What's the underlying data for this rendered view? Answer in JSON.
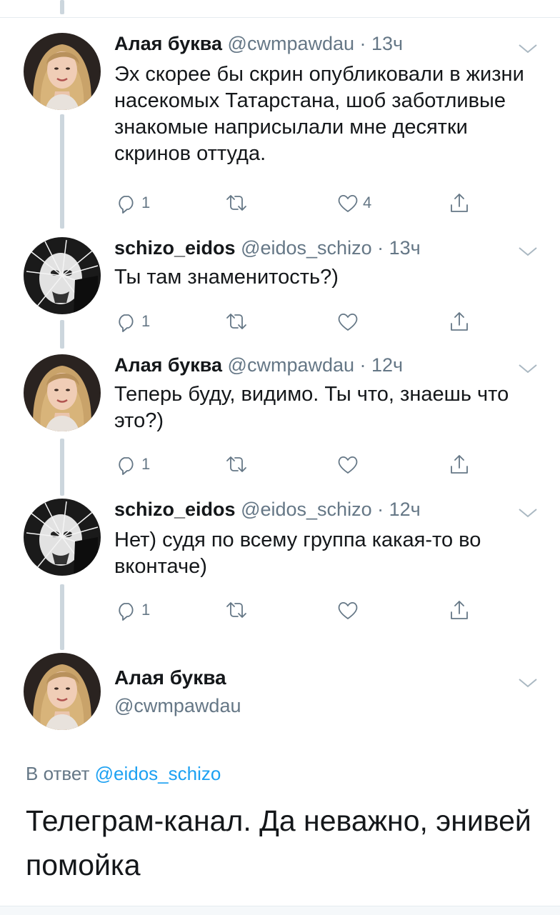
{
  "tweets": [
    {
      "name": "Алая буква",
      "meta": "@cwmpawdau · 13ч",
      "text": "Эх скорее бы скрин опубликовали в жизни насекомых Татарстана, шоб заботливые знакомые наприсылали мне десятки скринов оттуда.",
      "reply_count": "1",
      "retweet_count": "",
      "like_count": "4",
      "avatar": "woman-portrait"
    },
    {
      "name": "schizo_eidos",
      "meta": "@eidos_schizo · 13ч",
      "text": "Ты там знаменитость?)",
      "reply_count": "1",
      "retweet_count": "",
      "like_count": "",
      "avatar": "bw-spiked-face"
    },
    {
      "name": "Алая буква",
      "meta": "@cwmpawdau · 12ч",
      "text": "Теперь буду, видимо. Ты что, знаешь что это?)",
      "reply_count": "1",
      "retweet_count": "",
      "like_count": "",
      "avatar": "woman-portrait"
    },
    {
      "name": "schizo_eidos",
      "meta": "@eidos_schizo · 12ч",
      "text": "Нет) судя по всему группа какая-то во вконтаче)",
      "reply_count": "1",
      "retweet_count": "",
      "like_count": "",
      "avatar": "bw-spiked-face"
    }
  ],
  "main_tweet": {
    "name": "Алая буква",
    "handle": "@cwmpawdau",
    "replying_prefix": "В ответ",
    "replying_to": "@eidos_schizo",
    "text": "Телеграм-канал. Да неважно, энивей помойка"
  },
  "colors": {
    "text": "#14171a",
    "secondary": "#657786",
    "link": "#1da1f2",
    "thread_line": "#ccd6dd"
  },
  "icons": [
    "reply-icon",
    "retweet-icon",
    "like-icon",
    "share-icon",
    "chevron-down-icon"
  ]
}
